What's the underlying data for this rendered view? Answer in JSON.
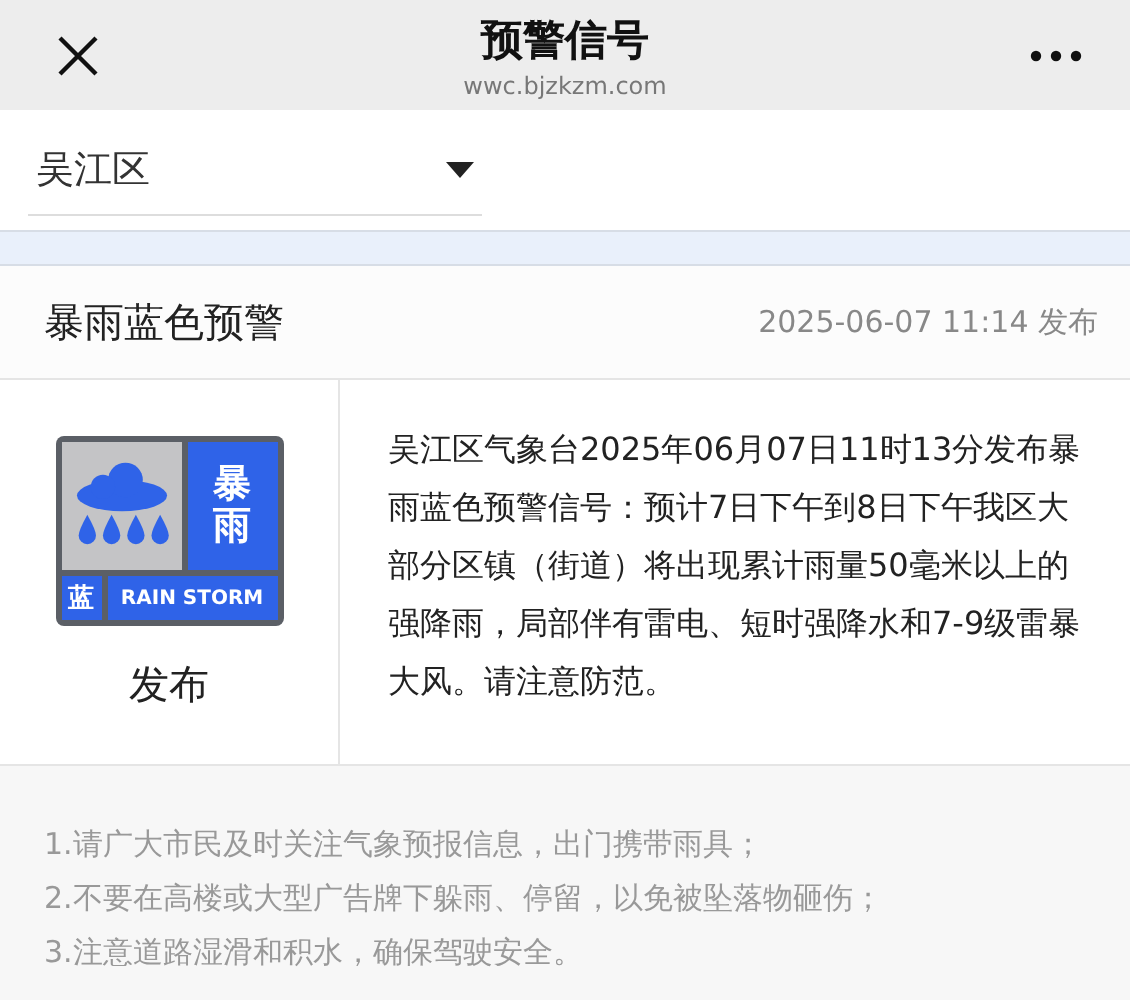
{
  "header": {
    "title": "预警信号",
    "url": "wwc.bjzkzm.com"
  },
  "district_select": {
    "value": "吴江区"
  },
  "warning": {
    "title": "暴雨蓝色预警",
    "time": "2025-06-07 11:14 发布",
    "badge": {
      "type_chars": "暴雨",
      "level_char": "蓝",
      "english": "RAIN STORM",
      "color": "#2f63e8"
    },
    "status": "发布",
    "text": "吴江区气象台2025年06月07日11时13分发布暴雨蓝色预警信号：预计7日下午到8日下午我区大部分区镇（街道）将出现累计雨量50毫米以上的强降雨，局部伴有雷电、短时强降水和7-9级雷暴大风。请注意防范。"
  },
  "tips": [
    "1.请广大市民及时关注气象预报信息，出门携带雨具；",
    "2.不要在高楼或大型广告牌下躲雨、停留，以免被坠落物砸伤；",
    "3.注意道路湿滑和积水，确保驾驶安全。"
  ]
}
